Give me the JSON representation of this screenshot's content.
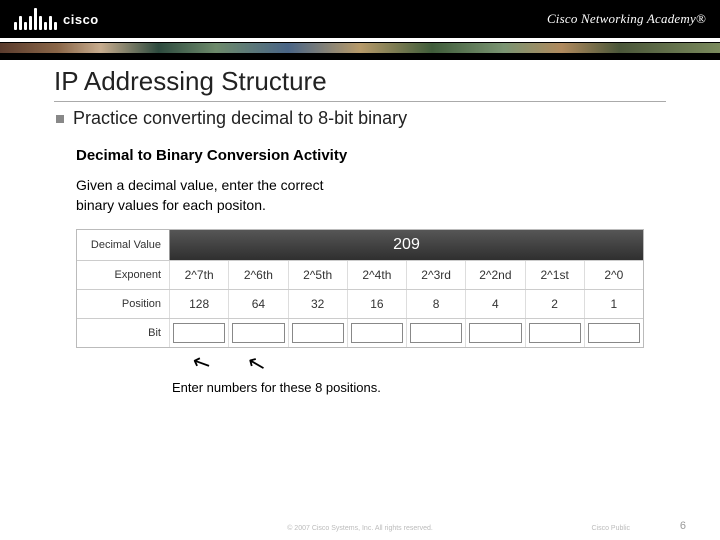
{
  "header": {
    "brand": "cisco",
    "academy": "Cisco Networking Academy®"
  },
  "slide": {
    "title": "IP Addressing Structure",
    "bullet": "Practice converting decimal to 8-bit binary"
  },
  "activity": {
    "title": "Decimal to Binary Conversion Activity",
    "desc1": "Given a decimal value, enter the correct",
    "desc2": "binary values for each positon.",
    "decimal_label": "Decimal Value",
    "decimal_value": "209",
    "rows": {
      "exponent_label": "Exponent",
      "position_label": "Position",
      "bit_label": "Bit"
    },
    "exponents": [
      "2^7th",
      "2^6th",
      "2^5th",
      "2^4th",
      "2^3rd",
      "2^2nd",
      "2^1st",
      "2^0"
    ],
    "positions": [
      "128",
      "64",
      "32",
      "16",
      "8",
      "4",
      "2",
      "1"
    ],
    "caption": "Enter numbers for these 8 positions."
  },
  "footer": {
    "copyright": "© 2007 Cisco Systems, Inc. All rights reserved.",
    "right": "Cisco Public",
    "page": "6"
  },
  "chart_data": {
    "type": "table",
    "title": "Decimal to Binary Conversion Activity",
    "decimal_value": 209,
    "columns": [
      "2^7th",
      "2^6th",
      "2^5th",
      "2^4th",
      "2^3rd",
      "2^2nd",
      "2^1st",
      "2^0"
    ],
    "position_weights": [
      128,
      64,
      32,
      16,
      8,
      4,
      2,
      1
    ],
    "bit_inputs": [
      null,
      null,
      null,
      null,
      null,
      null,
      null,
      null
    ]
  }
}
